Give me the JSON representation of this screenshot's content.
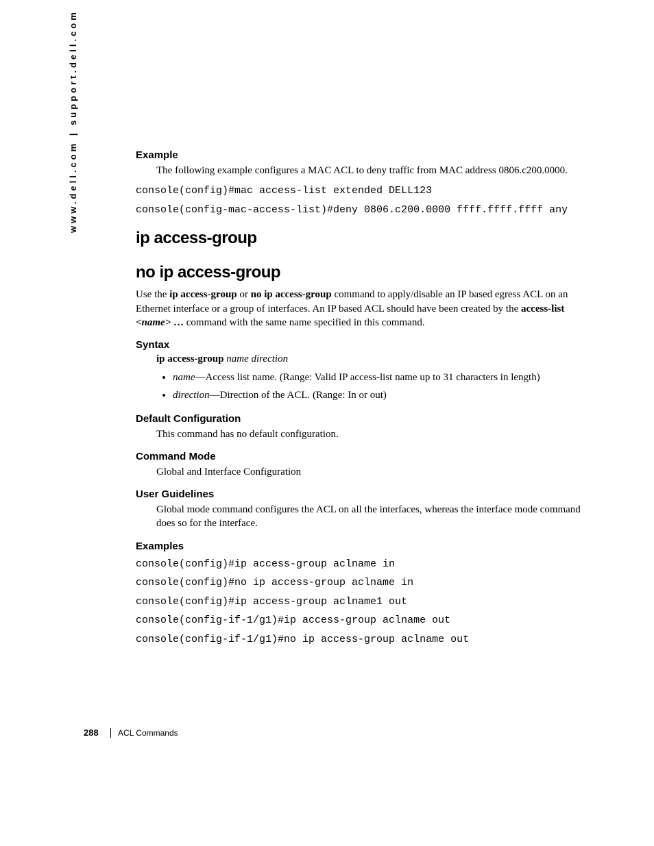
{
  "sidebar": "www.dell.com | support.dell.com",
  "sections": {
    "example1": {
      "heading": "Example",
      "body": "The following example configures a MAC ACL to deny traffic from MAC address 0806.c200.0000.",
      "code1": "console(config)#mac access-list extended DELL123",
      "code2": "console(config-mac-access-list)#deny 0806.c200.0000 ffff.ffff.ffff any"
    },
    "title1": "ip access-group",
    "title2": "no ip access-group",
    "intro": {
      "p1a": "Use the ",
      "p1b": "ip access-group",
      "p1c": " or ",
      "p1d": "no ip access-group",
      "p1e": " command to apply/disable an IP based egress ACL on an Ethernet interface or a group of interfaces. An IP based ACL should have been created by the ",
      "p1f": "access-list ",
      "p1g": "<name>",
      "p1h": " … ",
      "p1i": "command with the same name specified in this command."
    },
    "syntax": {
      "heading": "Syntax",
      "line_b": "ip access-group",
      "line_i": " name direction",
      "bullet1_i": "name",
      "bullet1_t": "—Access list name. (Range: Valid IP access-list name up to 31 characters in length)",
      "bullet2_i": "direction",
      "bullet2_t": "—Direction of the ACL. (Range: In or out)"
    },
    "defcfg": {
      "heading": "Default Configuration",
      "body": "This command has no default configuration."
    },
    "cmdmode": {
      "heading": "Command Mode",
      "body": "Global and Interface Configuration"
    },
    "userguide": {
      "heading": "User Guidelines",
      "body": "Global mode command configures the ACL on all the interfaces, whereas the interface mode command does so for the interface."
    },
    "examples": {
      "heading": "Examples",
      "c1": "console(config)#ip access-group aclname in",
      "c2": "console(config)#no ip access-group aclname in",
      "c3": "console(config)#ip access-group aclname1 out",
      "c4": "console(config-if-1/g1)#ip access-group aclname out",
      "c5": "console(config-if-1/g1)#no ip access-group aclname out"
    }
  },
  "footer": {
    "page": "288",
    "chapter": "ACL Commands"
  }
}
